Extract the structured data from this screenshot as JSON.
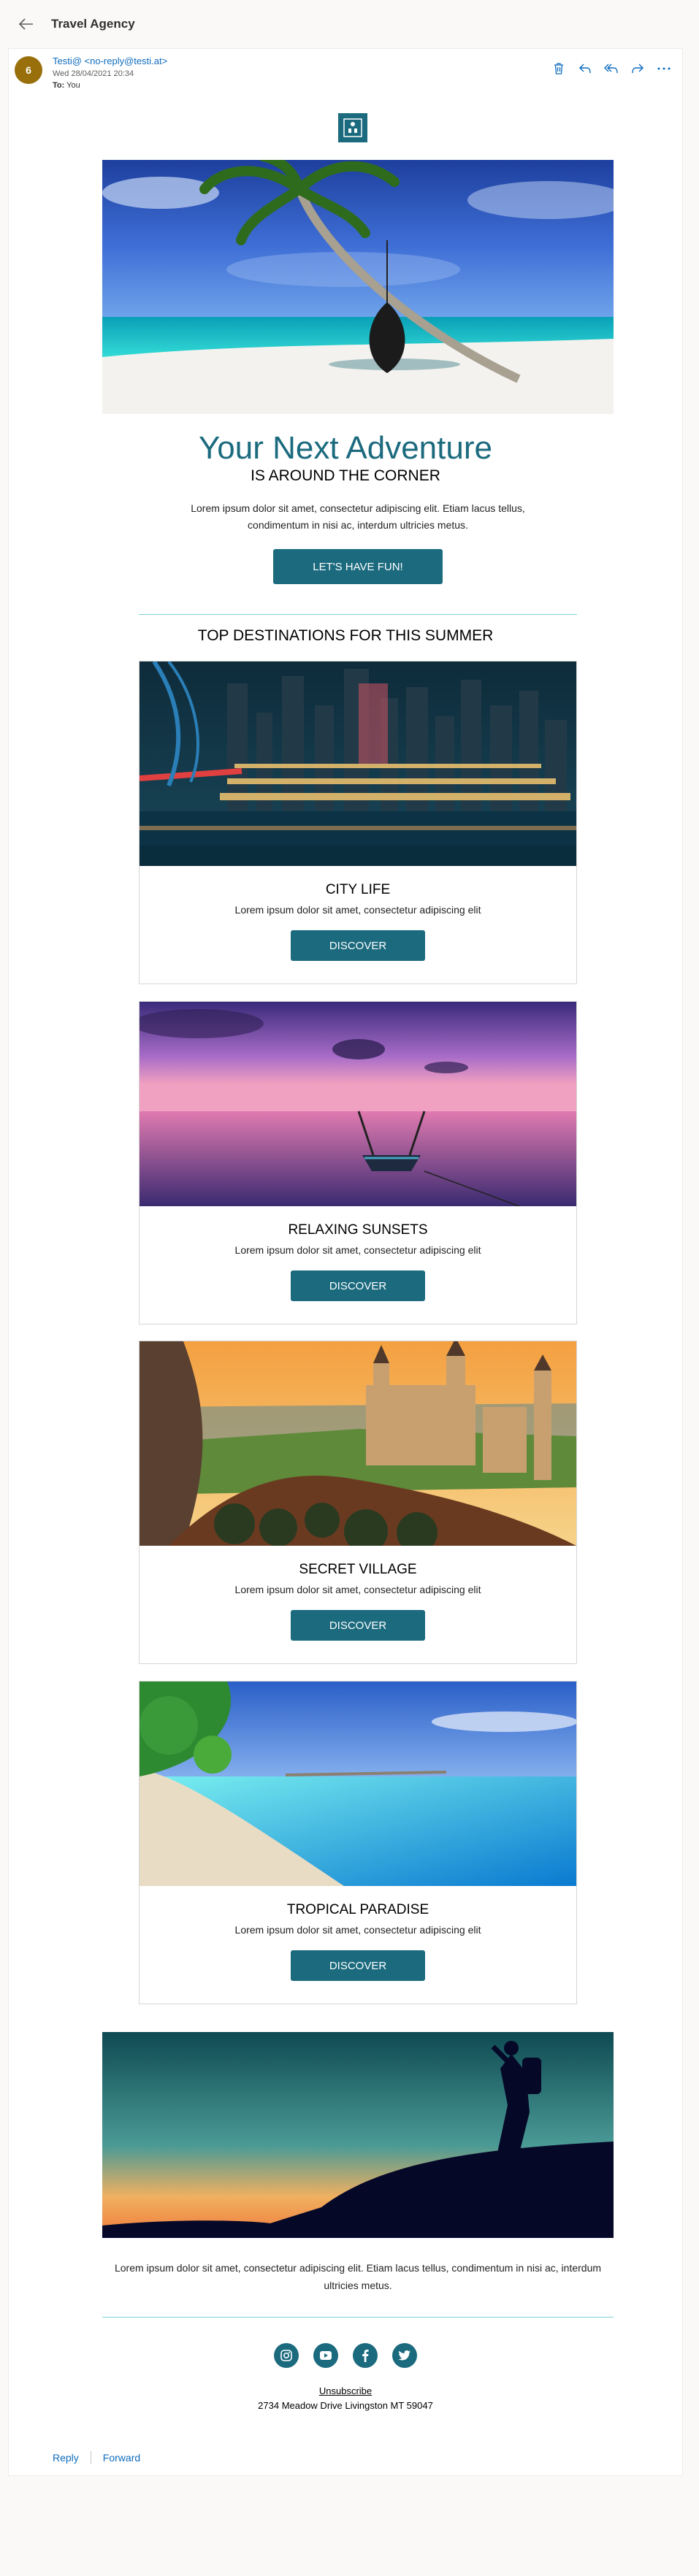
{
  "app": {
    "title": "Travel Agency"
  },
  "message": {
    "avatar_initial": "6",
    "sender": "Testi@ <no-reply@testi.at>",
    "date": "Wed 28/04/2021 20:34",
    "to_label": "To:",
    "to_value": "You"
  },
  "email": {
    "hero_title": "Your Next Adventure",
    "hero_subtitle": "IS AROUND THE CORNER",
    "hero_body": "Lorem ipsum dolor sit amet, consectetur adipiscing elit. Etiam lacus tellus, condimentum in nisi ac, interdum ultricies metus.",
    "hero_button": "LET'S HAVE FUN!",
    "section_title": "TOP DESTINATIONS FOR THIS SUMMER",
    "destinations": [
      {
        "name": "CITY LIFE",
        "text": "Lorem ipsum dolor sit amet, consectetur adipiscing elit",
        "button": "DISCOVER"
      },
      {
        "name": "RELAXING SUNSETS",
        "text": "Lorem ipsum dolor sit amet, consectetur adipiscing elit",
        "button": "DISCOVER"
      },
      {
        "name": "SECRET VILLAGE",
        "text": "Lorem ipsum dolor sit amet, consectetur adipiscing elit",
        "button": "DISCOVER"
      },
      {
        "name": "TROPICAL PARADISE",
        "text": "Lorem ipsum dolor sit amet, consectetur adipiscing elit",
        "button": "DISCOVER"
      }
    ],
    "footer_body": "Lorem ipsum dolor sit amet, consectetur adipiscing elit. Etiam lacus tellus, condimentum in nisi ac, interdum ultricies metus.",
    "social_icons": [
      "instagram-icon",
      "youtube-icon",
      "facebook-icon",
      "twitter-icon"
    ],
    "unsubscribe": "Unsubscribe",
    "address": "2734 Meadow Drive Livingston MT 59047"
  },
  "footer_actions": {
    "reply": "Reply",
    "forward": "Forward"
  },
  "colors": {
    "brand": "#1b6a7e",
    "link": "#0f6cbd",
    "avatar": "#986f0b",
    "divider": "#7dd3d6"
  }
}
